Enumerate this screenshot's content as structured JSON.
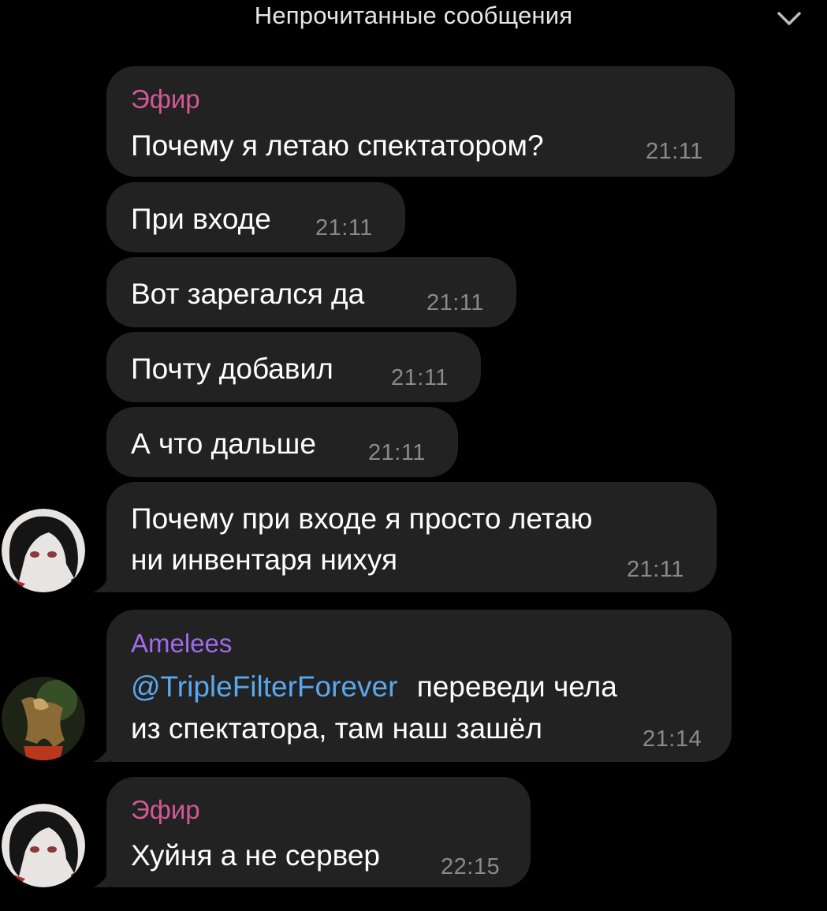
{
  "header": {
    "unread_label": "Непрочитанные сообщения",
    "collapse_icon": "chevron-down-icon"
  },
  "colors": {
    "background": "#000000",
    "bubble": "#222222",
    "efir_name": "#d35896",
    "amelees_name": "#a06bea",
    "mention": "#5aa8ec",
    "timestamp": "#8a8a8a"
  },
  "messages": [
    {
      "sender": "Эфир",
      "text": "Почему я летаю спектатором?",
      "time": "21:11"
    },
    {
      "text": "При входе",
      "time": "21:11"
    },
    {
      "text": "Вот зарегался да",
      "time": "21:11"
    },
    {
      "text": "Почту добавил",
      "time": "21:11"
    },
    {
      "text": "А что дальше",
      "time": "21:11"
    },
    {
      "text_line1": "Почему при входе я просто летаю",
      "text_line2": "ни инвентаря нихуя",
      "time": "21:11"
    },
    {
      "sender": "Amelees",
      "mention": "@TripleFilterForever",
      "text_line1_rest": "переведи чела",
      "text_line2": "из спектатора, там наш зашёл",
      "time": "21:14"
    },
    {
      "sender": "Эфир",
      "text": "Хуйня а не сервер",
      "time": "22:15"
    }
  ]
}
